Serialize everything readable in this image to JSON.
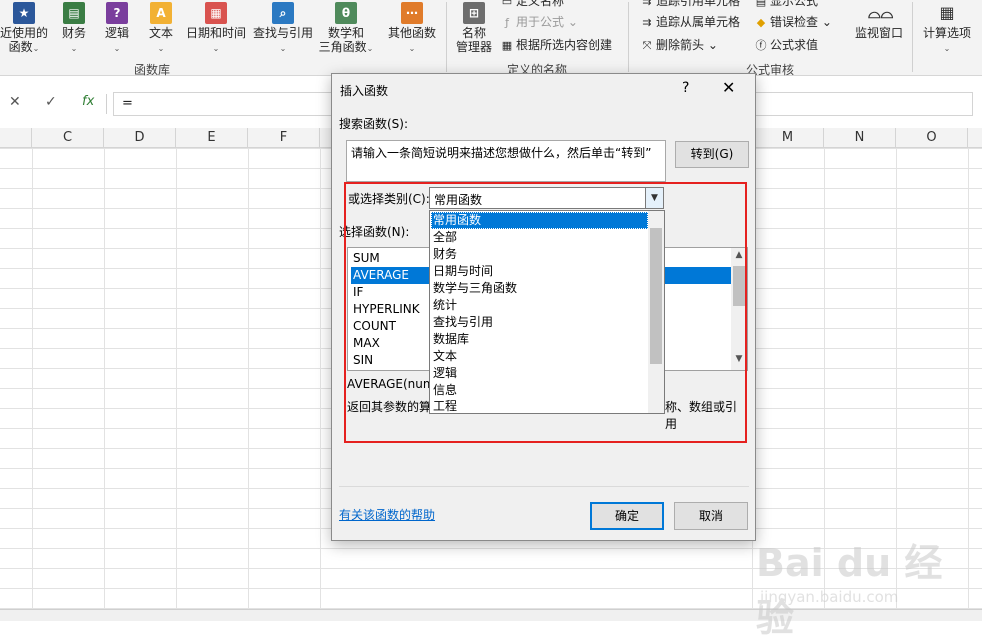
{
  "ribbon": {
    "buttons": [
      {
        "label1": "近使用的",
        "label2": "函数",
        "icon": "star-icon"
      },
      {
        "label1": "财务",
        "label2": "",
        "icon": "finance-icon"
      },
      {
        "label1": "逻辑",
        "label2": "",
        "icon": "logic-icon"
      },
      {
        "label1": "文本",
        "label2": "",
        "icon": "text-icon"
      },
      {
        "label1": "日期和时间",
        "label2": "",
        "icon": "calendar-icon"
      },
      {
        "label1": "查找与引用",
        "label2": "",
        "icon": "lookup-icon"
      },
      {
        "label1": "数学和",
        "label2": "三角函数",
        "icon": "math-icon"
      },
      {
        "label1": "其他函数",
        "label2": "",
        "icon": "more-functions-icon"
      }
    ],
    "group_library": "函数库",
    "name_manager": {
      "label1": "名称",
      "label2": "管理器"
    },
    "define_name": "定义名称",
    "use_in_formula": "用于公式",
    "create_from_selection": "根据所选内容创建",
    "group_defined_names": "定义的名称",
    "trace_precedents": "追踪引用单元格",
    "trace_dependents": "追踪从属单元格",
    "remove_arrows": "删除箭头",
    "show_formulas": "显示公式",
    "error_checking": "错误检查",
    "evaluate_formula": "公式求值",
    "group_auditing": "公式审核",
    "watch_window": "监视窗口",
    "calc_options": "计算选项"
  },
  "formula_bar": {
    "value": "="
  },
  "columns": [
    "C",
    "D",
    "E",
    "F",
    "M",
    "N",
    "O"
  ],
  "dialog": {
    "title": "插入函数",
    "help": "?",
    "close": "✕",
    "search_label": "搜索函数(S):",
    "search_text": "请输入一条简短说明来描述您想做什么，然后单击“转到”",
    "go_button": "转到(G)",
    "category_label": "或选择类别(C):",
    "category_value": "常用函数",
    "function_label": "选择函数(N):",
    "functions": [
      "SUM",
      "AVERAGE",
      "IF",
      "HYPERLINK",
      "COUNT",
      "MAX",
      "SIN"
    ],
    "selected_function": "AVERAGE",
    "syntax": "AVERAGE(num",
    "description_left": "返回其参数的算",
    "description_right": "称、数组或引用",
    "help_link": "有关该函数的帮助",
    "ok_button": "确定",
    "cancel_button": "取消"
  },
  "category_dropdown": {
    "items": [
      "常用函数",
      "全部",
      "财务",
      "日期与时间",
      "数学与三角函数",
      "统计",
      "查找与引用",
      "数据库",
      "文本",
      "逻辑",
      "信息",
      "工程"
    ],
    "selected": "常用函数"
  },
  "watermark": {
    "logo": "Bai du 经验",
    "url": "jingyan.baidu.com"
  },
  "colors": {
    "accent": "#0078d7",
    "annotation": "#e5211f"
  }
}
